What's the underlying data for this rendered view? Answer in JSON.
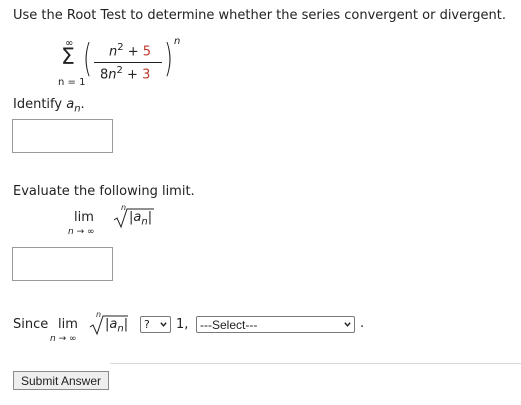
{
  "question": {
    "instruction": "Use the Root Test to determine whether the series convergent or divergent."
  },
  "series": {
    "sum_top": "∞",
    "sum_symbol": "Σ",
    "sum_bottom": "n = 1",
    "numerator": "n² + 5",
    "numerator_var": "n",
    "numerator_exp": "2",
    "numerator_rest": " + ",
    "numerator_const": "5",
    "denominator_coef": "8",
    "denominator_var": "n",
    "denominator_exp": "2",
    "denominator_rest": " + ",
    "denominator_const": "3",
    "outer_exponent": "n"
  },
  "identify": {
    "label": "Identify ",
    "var": "a",
    "sub": "n",
    "suffix": "."
  },
  "evaluate": {
    "label": "Evaluate the following limit.",
    "lim": "lim",
    "lim_sub": "n → ∞",
    "root_index": "n",
    "abs_open": "|a",
    "abs_sub": "n",
    "abs_close": "|"
  },
  "since": {
    "label": "Since",
    "lim": "lim",
    "lim_sub": "n → ∞",
    "root_index": "n",
    "abs_open": "|a",
    "abs_sub": "n",
    "abs_close": "|",
    "compare_value": "?",
    "one_label": "1,",
    "select_value": "---Select---",
    "period": "."
  },
  "submit_label": "Submit Answer"
}
